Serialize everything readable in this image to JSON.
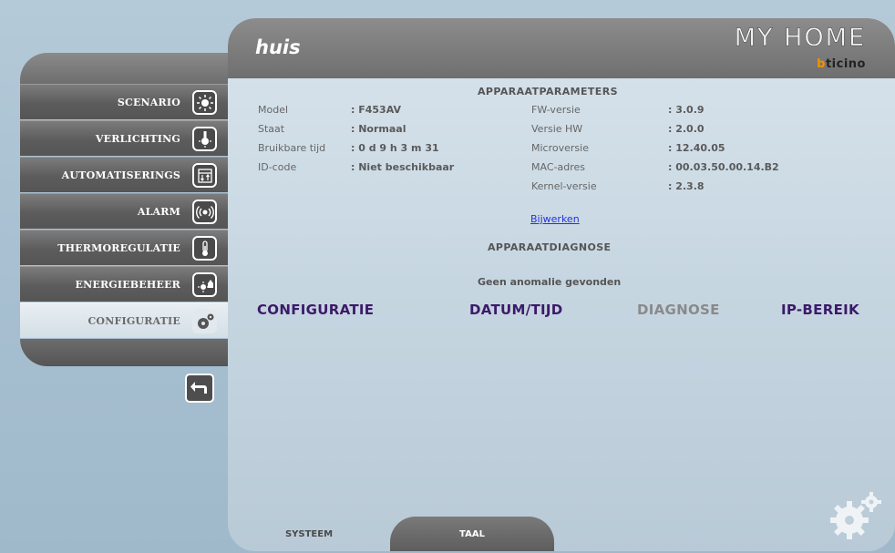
{
  "sidebar": {
    "items": [
      {
        "label": "SCENARIO",
        "icon": "scenario-icon",
        "active": false
      },
      {
        "label": "VERLICHTING",
        "icon": "lightbulb-icon",
        "active": false
      },
      {
        "label": "AUTOMATISERINGS",
        "icon": "shutter-icon",
        "active": false
      },
      {
        "label": "ALARM",
        "icon": "alarm-icon",
        "active": false
      },
      {
        "label": "THERMOREGULATIE",
        "icon": "thermometer-icon",
        "active": false
      },
      {
        "label": "ENERGIEBEHEER",
        "icon": "energy-icon",
        "active": false
      },
      {
        "label": "CONFIGURATIE",
        "icon": "gear-icon",
        "active": true
      }
    ],
    "back_icon": "back-arrow-icon"
  },
  "header": {
    "title": "huis",
    "logo": "MY HOME",
    "brand_b": "b",
    "brand_rest": "ticino"
  },
  "params": {
    "title": "APPARAATPARAMETERS",
    "left": [
      {
        "key": "Model",
        "value": ": F453AV"
      },
      {
        "key": "Staat",
        "value": ": Normaal"
      },
      {
        "key": "Bruikbare tijd",
        "value": ": 0 d 9 h 3 m 31"
      },
      {
        "key": "ID-code",
        "value": ": Niet beschikbaar"
      }
    ],
    "right": [
      {
        "key": "FW-versie",
        "value": ": 3.0.9"
      },
      {
        "key": "Versie HW",
        "value": ": 2.0.0"
      },
      {
        "key": "Microversie",
        "value": ": 12.40.05"
      },
      {
        "key": "MAC-adres",
        "value": ": 00.03.50.00.14.B2"
      },
      {
        "key": "Kernel-versie",
        "value": ": 2.3.8"
      }
    ],
    "update_link": "Bijwerken"
  },
  "diagnostics": {
    "title": "APPARAATDIAGNOSE",
    "result": "Geen anomalie gevonden"
  },
  "tabs": {
    "configuratie": "CONFIGURATIE",
    "datum_tijd": "DATUM/TIJD",
    "diagnose": "DIAGNOSE",
    "ip_bereik": "IP-BEREIK"
  },
  "bottom_tabs": {
    "systeem": "SYSTEEM",
    "taal": "TAAL"
  },
  "colors": {
    "accent_brand": "#f39200",
    "tab_link": "#3c1a6a",
    "tab_disabled": "#8a8a8a",
    "link": "#2233dd"
  }
}
